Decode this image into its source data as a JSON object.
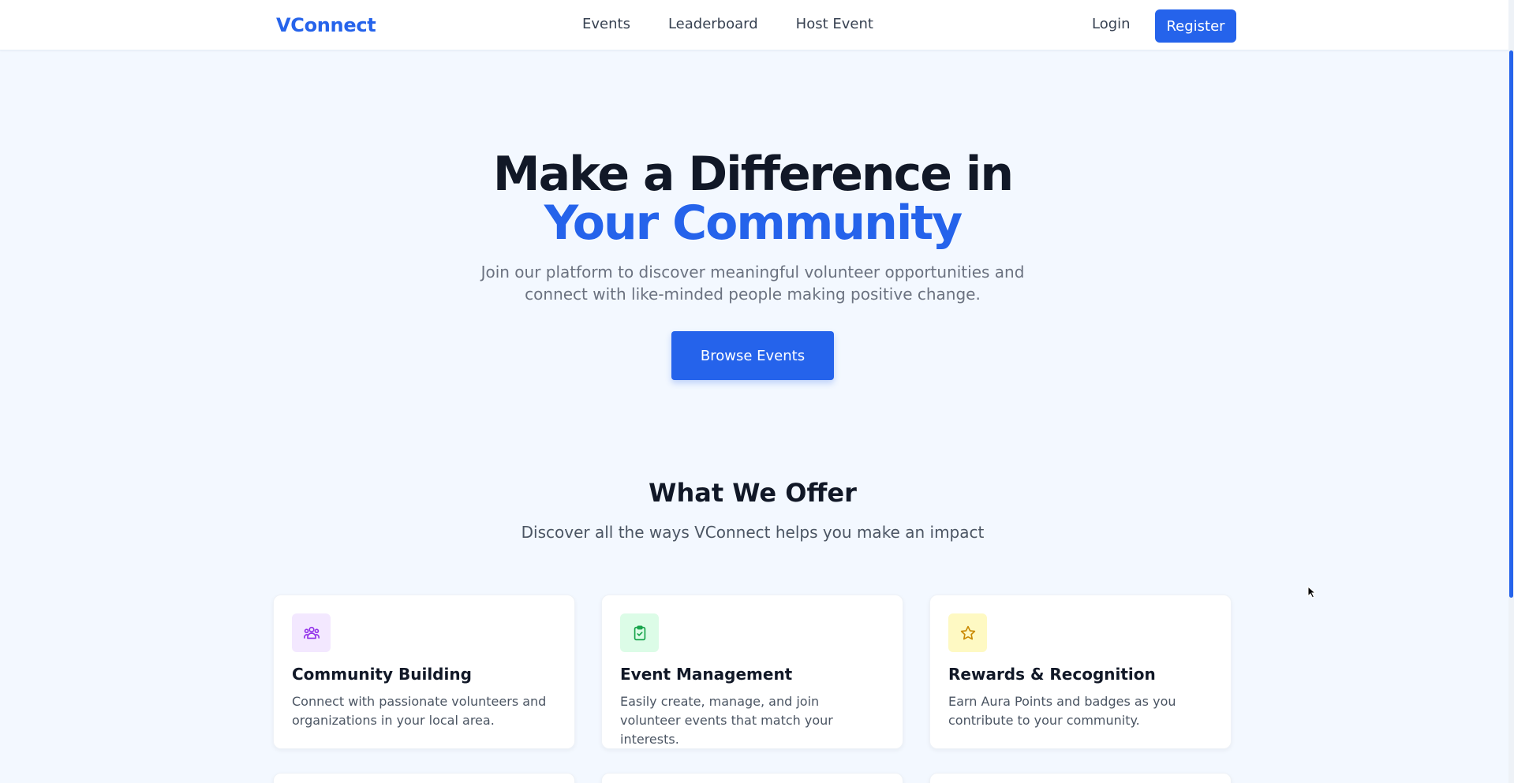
{
  "header": {
    "brand": "VConnect",
    "nav": [
      "Events",
      "Leaderboard",
      "Host Event"
    ],
    "login": "Login",
    "register": "Register"
  },
  "hero": {
    "title_line1": "Make a Difference in",
    "title_line2": "Your Community",
    "subtitle": "Join our platform to discover meaningful volunteer opportunities and connect with like-minded people making positive change.",
    "cta": "Browse Events"
  },
  "offer": {
    "title": "What We Offer",
    "subtitle": "Discover all the ways VConnect helps you make an impact",
    "cards": [
      {
        "icon": "users-group-icon",
        "title": "Community Building",
        "text": "Connect with passionate volunteers and organizations in your local area."
      },
      {
        "icon": "clipboard-check-icon",
        "title": "Event Management",
        "text": "Easily create, manage, and join volunteer events that match your interests."
      },
      {
        "icon": "star-icon",
        "title": "Rewards & Recognition",
        "text": "Earn Aura Points and badges as you contribute to your community."
      }
    ]
  },
  "colors": {
    "accent": "#2563eb",
    "community_icon_bg": "#f3e8ff",
    "community_icon": "#9333ea",
    "event_icon_bg": "#dcfce7",
    "event_icon": "#16a34a",
    "rewards_icon_bg": "#fef9c3",
    "rewards_icon": "#ca8a04"
  }
}
